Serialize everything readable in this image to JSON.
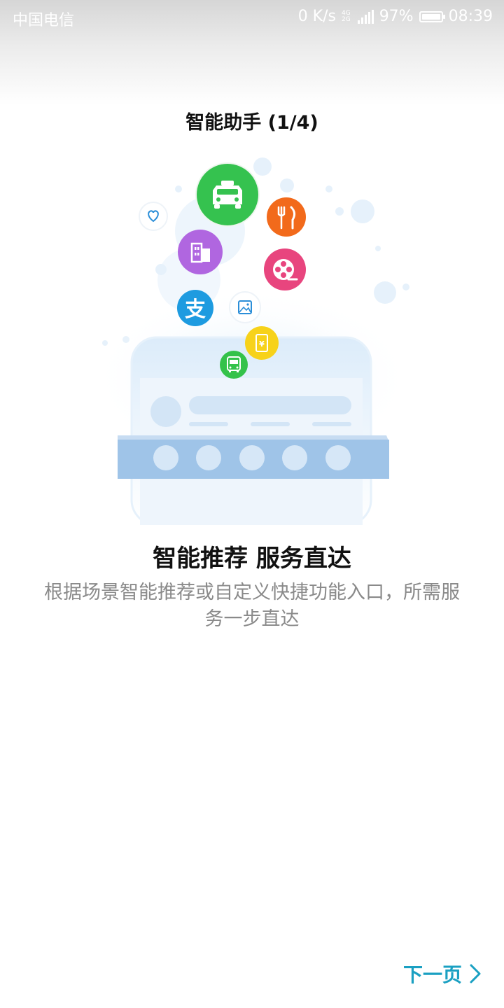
{
  "status_bar": {
    "carrier": "中国电信",
    "speed": "0 K/s",
    "network_top": "4G",
    "network_bottom": "2G",
    "battery": "97%",
    "battery_level": 0.97,
    "time": "08:39"
  },
  "page_title": "智能助手 (1/4)",
  "headline": "智能推荐 服务直达",
  "description": "根据场景智能推荐或自定义快捷功能入口，所需服务一步直达",
  "footer": {
    "next_label": "下一页"
  },
  "colors": {
    "accent": "#1aa0c2",
    "taxi": "#35c24f",
    "food": "#f26a1b",
    "video": "#e8457e",
    "building": "#b066e0",
    "alipay": "#1e9be0",
    "yuan": "#f7d21a",
    "bus": "#34c24a"
  },
  "icons": [
    "taxi-icon",
    "fork-knife-icon",
    "film-reel-icon",
    "building-icon",
    "alipay-icon",
    "image-icon",
    "yuan-phone-icon",
    "bus-icon",
    "heart-icon"
  ]
}
